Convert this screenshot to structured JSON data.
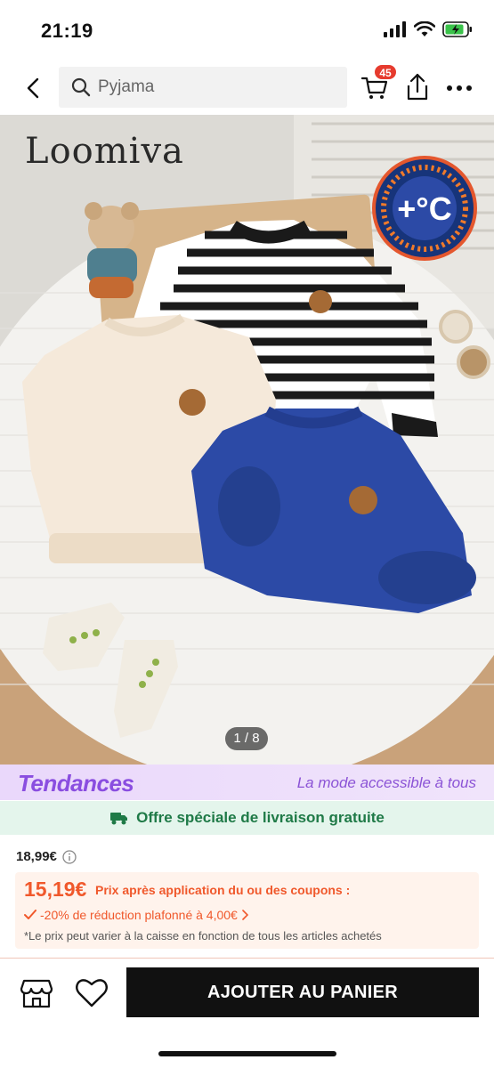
{
  "status_bar": {
    "time": "21:19"
  },
  "nav": {
    "search_placeholder": "Pyjama",
    "cart_count": "45",
    "icons": [
      "back-arrow-icon",
      "search-icon",
      "cart-icon",
      "share-icon",
      "more-icon"
    ]
  },
  "product_image": {
    "brand": "Loomiva",
    "badge_text": "+°C",
    "counter": "1 / 8"
  },
  "trends": {
    "logo": "Tendances",
    "tagline": "La mode accessible à tous"
  },
  "shipping": {
    "text": "Offre spéciale de livraison gratuite"
  },
  "price": {
    "original": "18,99€",
    "coupon_price": "15,19€",
    "coupon_label": "Prix après application du ou des coupons :",
    "discount": "-20% de réduction plafonné à 4,00€",
    "note": "*Le prix peut varier à la caisse en fonction de tous les articles achetés"
  },
  "bottom_bar": {
    "add_to_cart": "AJOUTER AU PANIER"
  },
  "colors": {
    "accent_orange": "#f0582b",
    "trends_purple": "#8a4ee0",
    "shipping_green": "#1f7a47",
    "cart_badge": "#e63b2e"
  }
}
